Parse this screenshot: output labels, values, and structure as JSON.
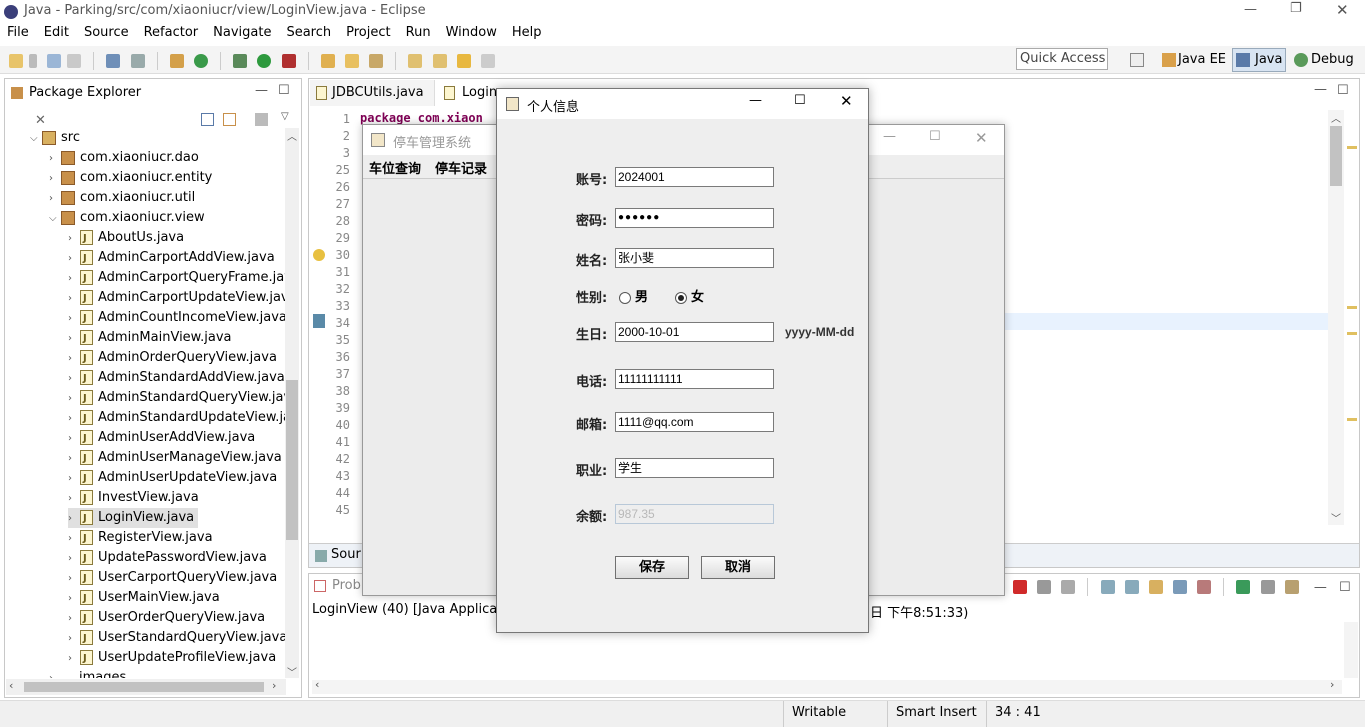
{
  "app": {
    "title": "Java - Parking/src/com/xiaoniucr/view/LoginView.java - Eclipse"
  },
  "menu": [
    "File",
    "Edit",
    "Source",
    "Refactor",
    "Navigate",
    "Search",
    "Project",
    "Run",
    "Window",
    "Help"
  ],
  "toolbar": {
    "quick_access": "Quick Access",
    "perspectives": [
      "Java EE",
      "Java",
      "Debug"
    ]
  },
  "package_explorer": {
    "title": "Package Explorer",
    "src": "src",
    "packages": [
      "com.xiaoniucr.dao",
      "com.xiaoniucr.entity",
      "com.xiaoniucr.util",
      "com.xiaoniucr.view"
    ],
    "files": [
      "AboutUs.java",
      "AdminCarportAddView.java",
      "AdminCarportQueryFrame.java",
      "AdminCarportUpdateView.java",
      "AdminCountIncomeView.java",
      "AdminMainView.java",
      "AdminOrderQueryView.java",
      "AdminStandardAddView.java",
      "AdminStandardQueryView.java",
      "AdminStandardUpdateView.jav",
      "AdminUserAddView.java",
      "AdminUserManageView.java",
      "AdminUserUpdateView.java",
      "InvestView.java",
      "LoginView.java",
      "RegisterView.java",
      "UpdatePasswordView.java",
      "UserCarportQueryView.java",
      "UserMainView.java",
      "UserOrderQueryView.java",
      "UserStandardQueryView.java",
      "UserUpdateProfileView.java"
    ],
    "partial": "images"
  },
  "editor": {
    "tabs": [
      "JDBCUtils.java",
      "Login"
    ],
    "line_numbers": [
      "1",
      "2",
      "3",
      "25",
      "26",
      "27",
      "28",
      "29",
      "30",
      "31",
      "32",
      "33",
      "34",
      "35",
      "36",
      "37",
      "38",
      "39",
      "40",
      "41",
      "42",
      "43",
      "44",
      "45"
    ],
    "code_first": "package com.xiaon",
    "bottom_tab": "Sour"
  },
  "console": {
    "tab": "Probl",
    "line": "LoginView (40) [Java Application",
    "line_tail": "日 下午8:51:33)"
  },
  "parking_window": {
    "title": "停车管理系统",
    "menu": [
      "车位查询",
      "停车记录"
    ]
  },
  "dialog": {
    "title": "个人信息",
    "account_label": "账号:",
    "account": "2024001",
    "password_label": "密码:",
    "password": "●●●●●●",
    "name_label": "姓名:",
    "name": "张小斐",
    "gender_label": "性别:",
    "gender_male": "男",
    "gender_female": "女",
    "birthday_label": "生日:",
    "birthday": "2000-10-01",
    "birthday_hint": "yyyy-MM-dd",
    "phone_label": "电话:",
    "phone": "11111111111",
    "email_label": "邮箱:",
    "email": "1111@qq.com",
    "job_label": "职业:",
    "job": "学生",
    "balance_label": "余额:",
    "balance": "987.35",
    "save": "保存",
    "cancel": "取消"
  },
  "status": {
    "writable": "Writable",
    "insert": "Smart Insert",
    "pos": "34 : 41"
  }
}
